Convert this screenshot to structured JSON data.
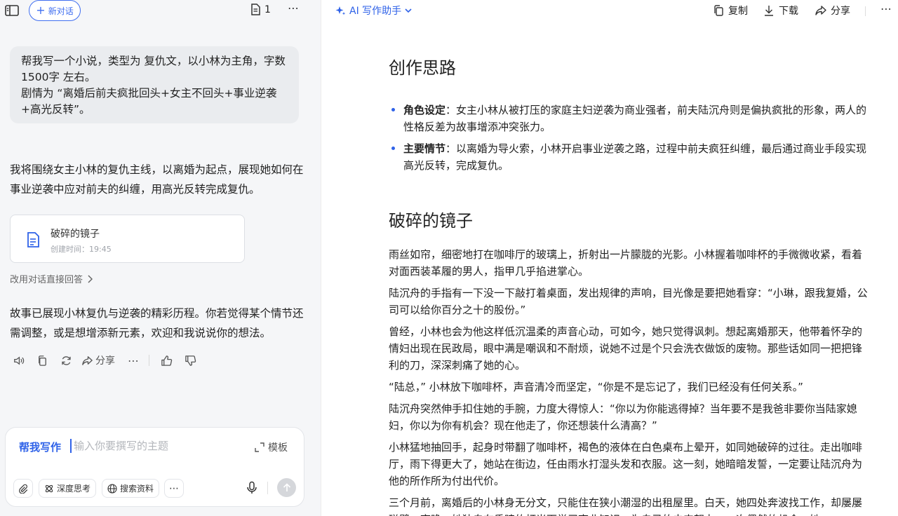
{
  "left_panel": {
    "new_chat_label": "新对话",
    "doc_count": "1",
    "user_message": [
      "帮我写一个小说，类型为 复仇文，以小林为主角，字数1500字 左右。",
      "剧情为 “离婚后前夫疯批回头+女主不回头+事业逆袭+高光反转”。"
    ],
    "ai_intro": "我将围绕女主小林的复仇主线，以离婚为起点，展现她如何在事业逆袭中应对前夫的纠缠，用高光反转完成复仇。",
    "doc_card": {
      "title": "破碎的镜子",
      "created": "创建时间：19:45"
    },
    "alt_answer": "改用对话直接回答",
    "ai_outro": "故事已展现小林复仇与逆袭的精彩历程。你若觉得某个情节还需调整，或是想增添新元素，欢迎和我说说你的想法。",
    "share_label": "分享",
    "composer": {
      "mode_label": "帮我写作",
      "placeholder": "输入你要撰写的主题",
      "template_label": "模板",
      "chip_deep_think": "深度思考",
      "chip_search": "搜索资料"
    }
  },
  "right_panel": {
    "assistant_label": "AI 写作助手",
    "copy_label": "复制",
    "download_label": "下载",
    "share_label": "分享",
    "section1_title": "创作思路",
    "bullets": [
      {
        "term": "角色设定",
        "text": "：女主小林从被打压的家庭主妇逆袭为商业强者，前夫陆沉舟则是偏执疯批的形象，两人的性格反差为故事增添冲突张力。"
      },
      {
        "term": "主要情节",
        "text": "：以离婚为导火索，小林开启事业逆袭之路，过程中前夫疯狂纠缠，最后通过商业手段实现高光反转，完成复仇。"
      }
    ],
    "section2_title": "破碎的镜子",
    "paragraphs": [
      "雨丝如帘，细密地打在咖啡厅的玻璃上，折射出一片朦胧的光影。小林握着咖啡杯的手微微收紧，看着对面西装革履的男人，指甲几乎掐进掌心。",
      "陆沉舟的手指有一下没一下敲打着桌面，发出规律的声响，目光像是要把她看穿：“小琳，跟我复婚，公司可以给你百分之十的股份。”",
      "曾经，小林也会为他这样低沉温柔的声音心动，可如今，她只觉得讽刺。想起离婚那天，他带着怀孕的情妇出现在民政局，眼中满是嘲讽和不耐烦，说她不过是个只会洗衣做饭的废物。那些话如同一把把锋利的刀，深深刺痛了她的心。",
      "“陆总，” 小林放下咖啡杯，声音清冷而坚定，“你是不是忘记了，我们已经没有任何关系。”",
      "陆沉舟突然伸手扣住她的手腕，力度大得惊人：“你以为你能逃得掉？当年要不是我爸非要你当陆家媳妇，你以为你有机会？现在他走了，你还想装什么清高？”",
      "小林猛地抽回手，起身时带翻了咖啡杯，褐色的液体在白色桌布上晕开，如同她破碎的过往。走出咖啡厅，雨下得更大了，她站在街边，任由雨水打湿头发和衣服。这一刻，她暗暗发誓，一定要让陆沉舟为他的所作所为付出代价。",
      "三个月前，离婚后的小林身无分文，只能住在狭小潮湿的出租屋里。白天，她四处奔波找工作，却屡屡碰壁；夜晚，她独自在昏暗的灯光下学习商业知识，为自己的未来努力。一次偶然的机会，她"
    ]
  }
}
